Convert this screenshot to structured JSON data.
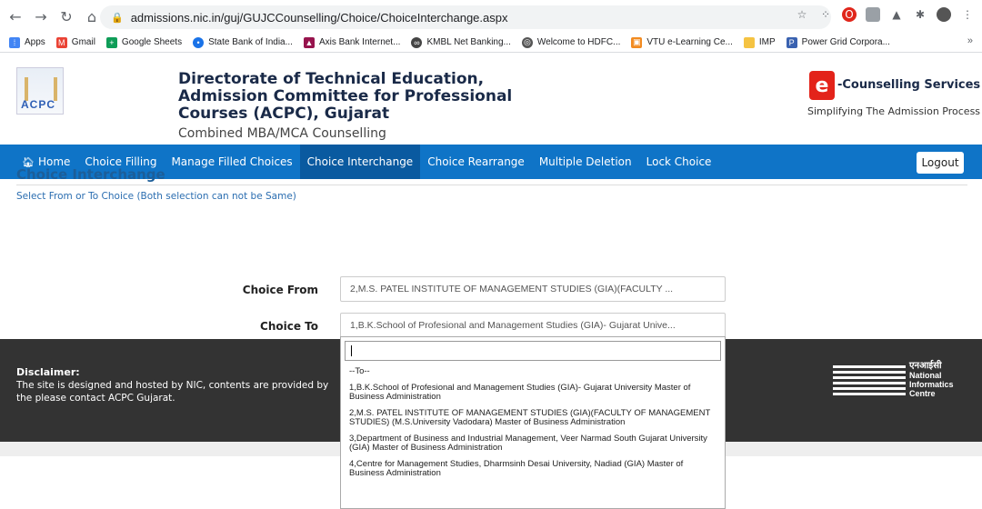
{
  "browser": {
    "url": "admissions.nic.in/guj/GUJCCounselling/Choice/ChoiceInterchange.aspx",
    "bookmarks": [
      {
        "label": "Apps",
        "color": "#4285f4"
      },
      {
        "label": "Gmail",
        "color": "#ea4335"
      },
      {
        "label": "Google Sheets",
        "color": "#0f9d58"
      },
      {
        "label": "State Bank of India...",
        "color": "#1a73e8"
      },
      {
        "label": "Axis Bank Internet...",
        "color": "#97144d"
      },
      {
        "label": "KMBL Net Banking...",
        "color": "#444444"
      },
      {
        "label": "Welcome to HDFC...",
        "color": "#555555"
      },
      {
        "label": "VTU e-Learning Ce...",
        "color": "#f28b20"
      },
      {
        "label": "IMP",
        "color": "#f5c342"
      },
      {
        "label": "Power Grid Corpora...",
        "color": "#3a62b0"
      }
    ],
    "bookmarks_more": "»"
  },
  "header": {
    "logo_text": "ACPC",
    "org_title": "Directorate of Technical Education, Admission Committee for Professional Courses (ACPC), Gujarat",
    "sub_title": "Combined MBA/MCA Counselling",
    "ec_logo_letter": "e",
    "ec_title": "-Counselling Services",
    "ec_tagline": "Simplifying The Admission Process"
  },
  "navbar": {
    "items": [
      "Home",
      "Choice Filling",
      "Manage Filled Choices",
      "Choice Interchange",
      "Choice Rearrange",
      "Multiple Deletion",
      "Lock Choice"
    ],
    "active": "Choice Interchange",
    "logout": "Logout"
  },
  "content": {
    "title": "Choice Interchange",
    "note": "Select From or To Choice (Both selection can not be Same)",
    "choice_from_label": "Choice From",
    "choice_from_value": "2,M.S. PATEL INSTITUTE OF MANAGEMENT STUDIES (GIA)(FACULTY ...",
    "choice_to_label": "Choice To",
    "choice_to_value": "1,B.K.School of Profesional and Management Studies (GIA)- Gujarat Unive..."
  },
  "dropdown": {
    "search_value": "",
    "options": [
      "--To--",
      "1,B.K.School of Profesional and Management Studies (GIA)- Gujarat University Master of Business Administration",
      "2,M.S. PATEL INSTITUTE OF MANAGEMENT STUDIES (GIA)(FACULTY OF MANAGEMENT STUDIES) (M.S.University Vadodara) Master of Business Administration",
      "3,Department of Business and Industrial Management, Veer Narmad South Gujarat University (GIA) Master of Business Administration",
      "4,Centre for Management Studies, Dharmsinh Desai University, Nadiad (GIA) Master of Business Administration"
    ]
  },
  "footer": {
    "disclaimer_title": "Disclaimer:",
    "disclaimer_text": "The site is designed and hosted by NIC, contents are provided by the please contact ACPC Gujarat.",
    "nic_hindi": "एनआईसी",
    "nic_line1": "National",
    "nic_line2": "Informatics",
    "nic_line3": "Centre"
  }
}
